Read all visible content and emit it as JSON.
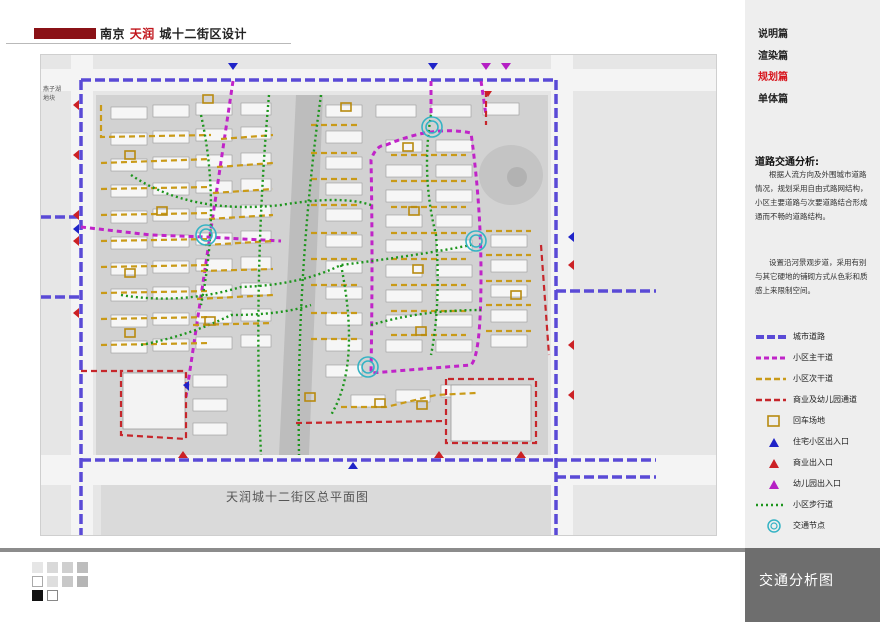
{
  "header": {
    "title_a": "南京 ",
    "title_accent": "天润",
    "title_b": " 城十二街区设计"
  },
  "nav": [
    {
      "label": "说明篇",
      "active": false
    },
    {
      "label": "渲染篇",
      "active": false
    },
    {
      "label": "规划篇",
      "active": true
    },
    {
      "label": "单体篇",
      "active": false
    }
  ],
  "analysis": {
    "title": "道路交通分析:",
    "para1": "根据人流方向及外围城市道路情况，规划采用自由式路网结构，小区主要道路与次要道路结合形成通而不畅的道路结构。",
    "para2": "设置沿河景观步道，采用有别与其它硬地的铺砌方式从色彩和质感上来限制空间。"
  },
  "legend": [
    {
      "label": "城市道路",
      "icon": "city-road-line"
    },
    {
      "label": "小区主干道",
      "icon": "main-road-line"
    },
    {
      "label": "小区次干道",
      "icon": "secondary-road-line"
    },
    {
      "label": "商业及幼儿园通道",
      "icon": "commercial-road-line"
    },
    {
      "label": "回车场地",
      "icon": "turnaround-square"
    },
    {
      "label": "住宅小区出入口",
      "icon": "residential-entrance-triangle"
    },
    {
      "label": "商业出入口",
      "icon": "commercial-entrance-triangle"
    },
    {
      "label": "幼儿园出入口",
      "icon": "kindergarten-entrance-triangle"
    },
    {
      "label": "小区步行道",
      "icon": "footpath-dotted-line"
    },
    {
      "label": "交通节点",
      "icon": "traffic-node-circle"
    }
  ],
  "map": {
    "side_label": "燕子湖\n地块",
    "plan_title": "天润城十二街区总平面图"
  },
  "footer": {
    "title": "交通分析图"
  },
  "colors": {
    "city_road": "#6b5bd6",
    "main_road": "#c024c8",
    "secondary_road": "#d39a1a",
    "commercial_road": "#c6262b",
    "footpath": "#1f9a1f",
    "node": "#35b3c4",
    "brand": "#8a1116"
  }
}
